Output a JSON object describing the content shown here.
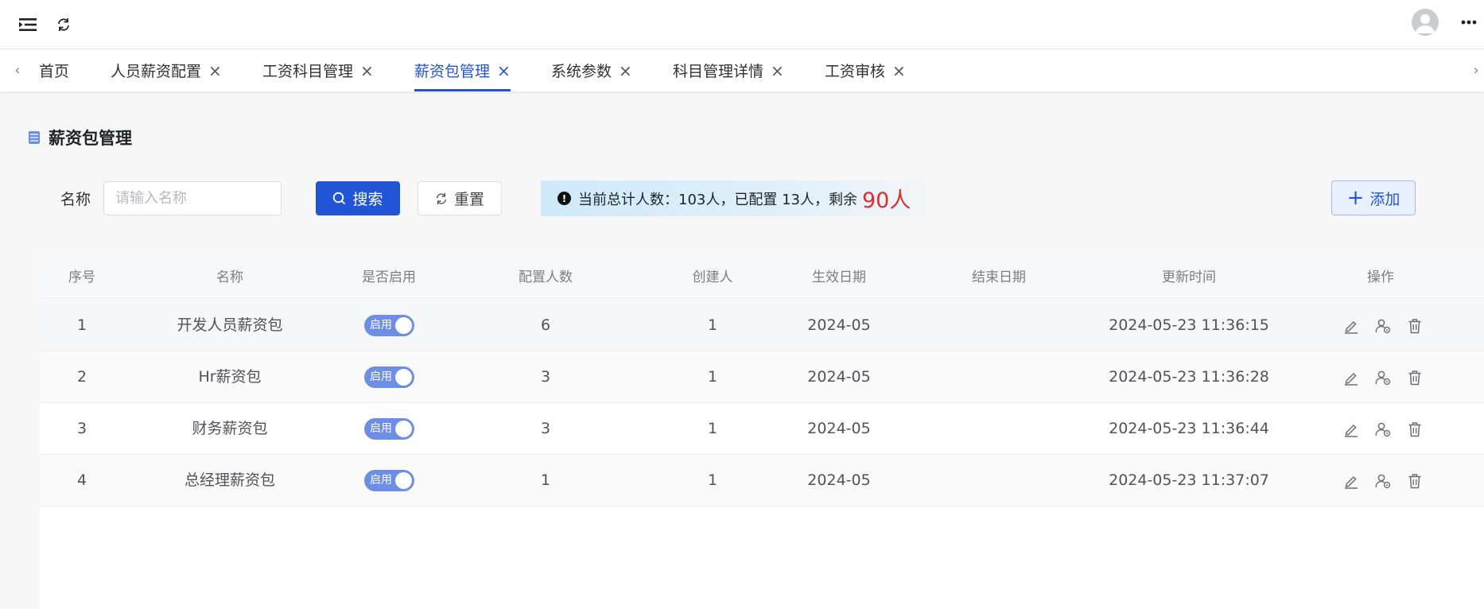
{
  "topbar": {
    "menu_icon": "menu-fold-icon",
    "refresh_icon": "refresh-icon",
    "avatar_icon": "user-avatar-icon",
    "more_icon": "more-dots-icon"
  },
  "tabs": [
    {
      "label": "首页",
      "closable": false,
      "active": false
    },
    {
      "label": "人员薪资配置",
      "closable": true,
      "active": false
    },
    {
      "label": "工资科目管理",
      "closable": true,
      "active": false
    },
    {
      "label": "薪资包管理",
      "closable": true,
      "active": true
    },
    {
      "label": "系统参数",
      "closable": true,
      "active": false
    },
    {
      "label": "科目管理详情",
      "closable": true,
      "active": false
    },
    {
      "label": "工资审核",
      "closable": true,
      "active": false
    }
  ],
  "page": {
    "title": "薪资包管理"
  },
  "search": {
    "name_label": "名称",
    "name_placeholder": "请输入名称",
    "name_value": "",
    "search_label": "搜索",
    "reset_label": "重置",
    "add_label": "添加"
  },
  "notice": {
    "text": "当前总计人数：103人，已配置 13人，剩余",
    "remaining": "90人"
  },
  "table": {
    "columns": [
      "序号",
      "名称",
      "是否启用",
      "配置人数",
      "创建人",
      "生效日期",
      "结束日期",
      "更新时间",
      "操作"
    ],
    "switch_label": "启用",
    "rows": [
      {
        "index": "1",
        "name": "开发人员薪资包",
        "enabled": true,
        "count": "6",
        "creator": "1",
        "start": "2024-05",
        "end": "",
        "updated": "2024-05-23 11:36:15"
      },
      {
        "index": "2",
        "name": "Hr薪资包",
        "enabled": true,
        "count": "3",
        "creator": "1",
        "start": "2024-05",
        "end": "",
        "updated": "2024-05-23 11:36:28"
      },
      {
        "index": "3",
        "name": "财务薪资包",
        "enabled": true,
        "count": "3",
        "creator": "1",
        "start": "2024-05",
        "end": "",
        "updated": "2024-05-23 11:36:44"
      },
      {
        "index": "4",
        "name": "总经理薪资包",
        "enabled": true,
        "count": "1",
        "creator": "1",
        "start": "2024-05",
        "end": "",
        "updated": "2024-05-23 11:37:07"
      }
    ]
  },
  "colors": {
    "primary": "#2155d6",
    "danger": "#e02b2b",
    "switch_on": "#6d8ee6"
  }
}
